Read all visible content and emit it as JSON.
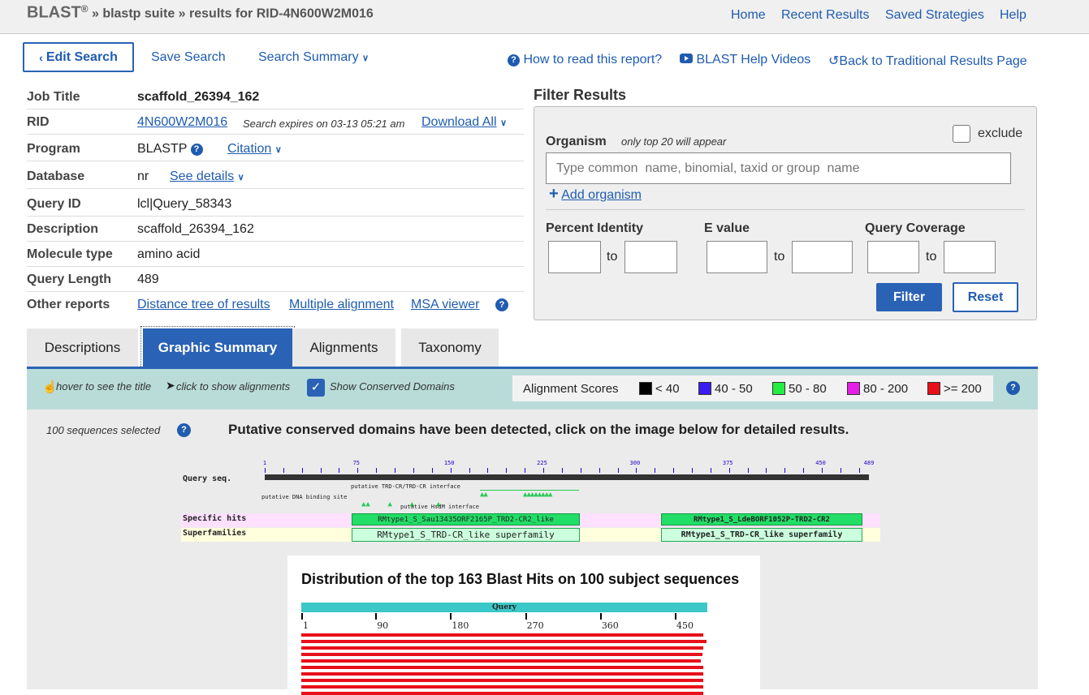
{
  "header": {
    "brand": "BLAST",
    "reg": "®",
    "crumb_suite": "» blastp suite",
    "crumb_results": "» results for RID-4N600W2M016",
    "nav": [
      "Home",
      "Recent Results",
      "Saved Strategies",
      "Help"
    ]
  },
  "toolbar": {
    "edit_search": "Edit Search",
    "save_search": "Save Search",
    "search_summary": "Search Summary",
    "how_to_read": "How to read this report?",
    "help_videos": "BLAST Help Videos",
    "back_traditional": "Back to Traditional Results Page"
  },
  "info": {
    "job_title_label": "Job Title",
    "job_title": "scaffold_26394_162",
    "rid_label": "RID",
    "rid": "4N600W2M016",
    "expires": "Search expires on 03-13 05:21 am",
    "download_all": "Download All",
    "program_label": "Program",
    "program": "BLASTP",
    "citation": "Citation",
    "database_label": "Database",
    "database": "nr",
    "see_details": "See details",
    "query_id_label": "Query ID",
    "query_id": "lcl|Query_58343",
    "description_label": "Description",
    "description": "scaffold_26394_162",
    "molecule_label": "Molecule type",
    "molecule": "amino acid",
    "query_length_label": "Query Length",
    "query_length": "489",
    "other_reports_label": "Other reports",
    "distance_tree": "Distance tree of results",
    "multiple_alignment": "Multiple alignment",
    "msa_viewer": "MSA viewer"
  },
  "filter": {
    "title": "Filter Results",
    "organism_label": "Organism",
    "organism_note": "only top 20 will appear",
    "exclude": "exclude",
    "organism_placeholder": "Type common  name, binomial, taxid or group  name",
    "add_organism": "Add organism",
    "percent_identity": "Percent Identity",
    "e_value": "E value",
    "query_coverage": "Query Coverage",
    "to": "to",
    "filter_btn": "Filter",
    "reset_btn": "Reset"
  },
  "tabs": [
    "Descriptions",
    "Graphic Summary",
    "Alignments",
    "Taxonomy"
  ],
  "legend": {
    "hover": "hover to see the title",
    "click": "click to show alignments",
    "show_cdd": "Show Conserved Domains",
    "scores_label": "Alignment Scores",
    "scores": [
      {
        "label": "< 40",
        "color": "#000000"
      },
      {
        "label": "40 - 50",
        "color": "#3a1cf0"
      },
      {
        "label": "50 - 80",
        "color": "#22ee44"
      },
      {
        "label": "80 - 200",
        "color": "#e61ee6"
      },
      {
        "label": ">= 200",
        "color": "#e8101a"
      }
    ]
  },
  "graphic": {
    "selected": "100 sequences selected",
    "cdd_message": "Putative conserved domains have been detected, click on the image below for detailed results.",
    "query_seq": "Query seq.",
    "ruler_ticks": [
      "1",
      "75",
      "150",
      "225",
      "300",
      "375",
      "450",
      "489"
    ],
    "site_trd": "putative TRD-CR/TRD-CR interface",
    "site_dna": "putative DNA binding site",
    "site_hsdm": "putative HsdM interface",
    "specific_hits": "Specific hits",
    "superfamilies": "Superfamilies",
    "hit1": "RMtype1_S_Sau13435ORF2165P_TRD2-CR2_like",
    "hit2": "RMtype1_S_LdeBORF1052P-TRD2-CR2",
    "super1": "RMtype1_S_TRD-CR_like superfamily",
    "super2": "RMtype1_S_TRD-CR_like superfamily",
    "dist_title": "Distribution of the top 163 Blast Hits on 100 subject sequences",
    "query_bar": "Query",
    "dist_ticks": [
      "1",
      "90",
      "180",
      "270",
      "360",
      "450"
    ]
  }
}
